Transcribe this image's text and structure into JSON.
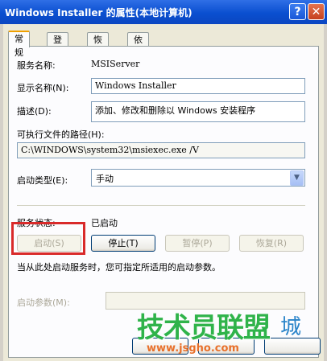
{
  "window": {
    "title": "Windows Installer 的属性(本地计算机)",
    "help_label": "?",
    "close_label": "✕"
  },
  "tabs": [
    "常规",
    "登录",
    "恢复",
    "依存关系"
  ],
  "general": {
    "service_name_label": "服务名称:",
    "service_name_value": "MSIServer",
    "display_name_label": "显示名称(N):",
    "display_name_value": "Windows Installer",
    "description_label": "描述(D):",
    "description_value": "添加、修改和删除以 Windows 安装程序",
    "exe_path_label": "可执行文件的路径(H):",
    "exe_path_value": "C:\\WINDOWS\\system32\\msiexec.exe /V",
    "startup_type_label": "启动类型(E):",
    "startup_type_value": "手动",
    "service_status_label": "服务状态:",
    "service_status_value": "已启动",
    "buttons": {
      "start": "启动(S)",
      "stop": "停止(T)",
      "pause": "暂停(P)",
      "resume": "恢复(R)"
    },
    "hint_text": "当从此处启动服务时，您可指定所适用的启动参数。",
    "start_params_label": "启动参数(M):",
    "start_params_value": ""
  },
  "watermark": {
    "text": "技术员联盟",
    "url": "www.jsgho.com",
    "tail": "城"
  },
  "icons": {
    "dropdown": "chevron-down-icon"
  },
  "colors": {
    "titlebar": "#0a4fd0",
    "highlight": "#d92a2a",
    "watermark_green": "#2fb34a",
    "watermark_orange": "#e8702a"
  }
}
